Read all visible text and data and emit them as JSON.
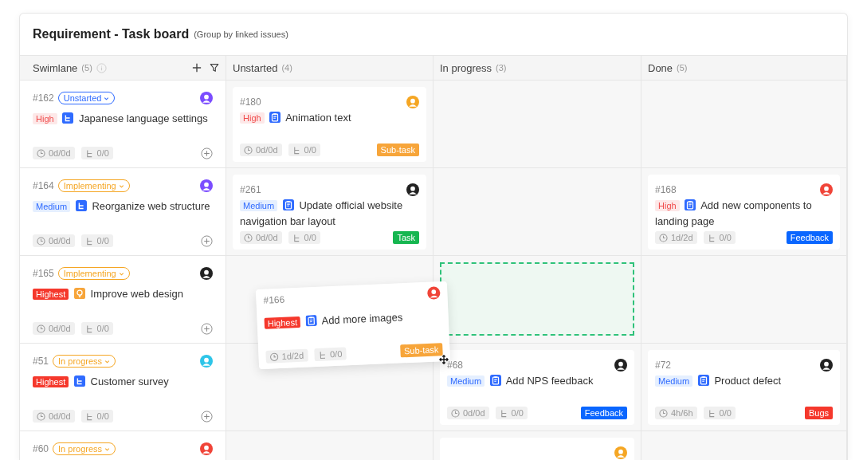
{
  "board": {
    "title": "Requirement - Task board",
    "subtitle": "(Group by linked issues)"
  },
  "columns": [
    {
      "label": "Swimlane",
      "count": "(5)"
    },
    {
      "label": "Unstarted",
      "count": "(4)"
    },
    {
      "label": "In progress",
      "count": "(3)"
    },
    {
      "label": "Done",
      "count": "(5)"
    }
  ],
  "rows": [
    {
      "swimlane": {
        "id": "#162",
        "status": {
          "label": "Unstarted",
          "color": "#2f6bff"
        },
        "avatar": {
          "color": "#7b4dff"
        },
        "priority": {
          "label": "High",
          "kind": "high"
        },
        "kind": "story",
        "title": "Japanese language settings",
        "time": "0d/0d",
        "subtasks": "0/0"
      },
      "unstarted": {
        "id": "#180",
        "avatar": {
          "color": "#f5a623"
        },
        "priority": {
          "label": "High",
          "kind": "high"
        },
        "kind": "task",
        "title": "Animation text",
        "time": "0d/0d",
        "subtasks": "0/0",
        "tag": {
          "label": "Sub-task",
          "color": "#f7a53a"
        }
      }
    },
    {
      "swimlane": {
        "id": "#164",
        "status": {
          "label": "Implementing",
          "color": "#f5a623"
        },
        "avatar": {
          "color": "#7b4dff"
        },
        "priority": {
          "label": "Medium",
          "kind": "medium"
        },
        "kind": "story",
        "title": "Reorganize web structure",
        "time": "0d/0d",
        "subtasks": "0/0"
      },
      "unstarted": {
        "id": "#261",
        "avatar": {
          "color": "#222222"
        },
        "priority": {
          "label": "Medium",
          "kind": "medium"
        },
        "kind": "task",
        "title": "Update official website navigation bar layout",
        "time": "0d/0d",
        "subtasks": "0/0",
        "tag": {
          "label": "Task",
          "color": "#16b650"
        }
      },
      "done": {
        "id": "#168",
        "avatar": {
          "color": "#f04438"
        },
        "priority": {
          "label": "High",
          "kind": "high"
        },
        "kind": "task",
        "title": "Add new components to landing page",
        "time": "1d/2d",
        "subtasks": "0/0",
        "tag": {
          "label": "Feedback",
          "color": "#0a66ff"
        }
      }
    },
    {
      "swimlane": {
        "id": "#165",
        "status": {
          "label": "Implementing",
          "color": "#f5a623"
        },
        "avatar": {
          "color": "#222222"
        },
        "priority": {
          "label": "Highest",
          "kind": "highest"
        },
        "kind": "idea",
        "title": "Improve web design",
        "time": "0d/0d",
        "subtasks": "0/0"
      },
      "in_progress": {
        "kind": "drop-target"
      }
    },
    {
      "swimlane": {
        "id": "#51",
        "status": {
          "label": "In progress",
          "color": "#f5a623"
        },
        "avatar": {
          "color": "#2ec5e8"
        },
        "priority": {
          "label": "Highest",
          "kind": "highest"
        },
        "kind": "story",
        "title": "Customer survey",
        "time": "0d/0d",
        "subtasks": "0/0"
      },
      "in_progress": {
        "id": "#68",
        "avatar": {
          "color": "#222222"
        },
        "priority": {
          "label": "Medium",
          "kind": "medium"
        },
        "kind": "task",
        "title": "Add NPS feedback",
        "time": "0d/0d",
        "subtasks": "0/0",
        "tag": {
          "label": "Feedback",
          "color": "#0a66ff"
        }
      },
      "done": {
        "id": "#72",
        "avatar": {
          "color": "#222222"
        },
        "priority": {
          "label": "Medium",
          "kind": "medium"
        },
        "kind": "task",
        "title": "Product defect",
        "time": "4h/6h",
        "subtasks": "0/0",
        "tag": {
          "label": "Bugs",
          "color": "#f5382c"
        }
      }
    },
    {
      "swimlane": {
        "id": "#60",
        "status": {
          "label": "In progress",
          "color": "#f5a623"
        },
        "avatar": {
          "color": "#f04438"
        }
      },
      "in_progress": {
        "avatar": {
          "color": "#f5a623"
        }
      }
    }
  ],
  "dragged_card": {
    "id": "#166",
    "avatar": {
      "color": "#f04438"
    },
    "priority": {
      "label": "Highest",
      "kind": "highest"
    },
    "kind": "task",
    "title": "Add more images",
    "time": "1d/2d",
    "subtasks": "0/0",
    "tag": {
      "label": "Sub-task",
      "color": "#f7a53a"
    }
  }
}
